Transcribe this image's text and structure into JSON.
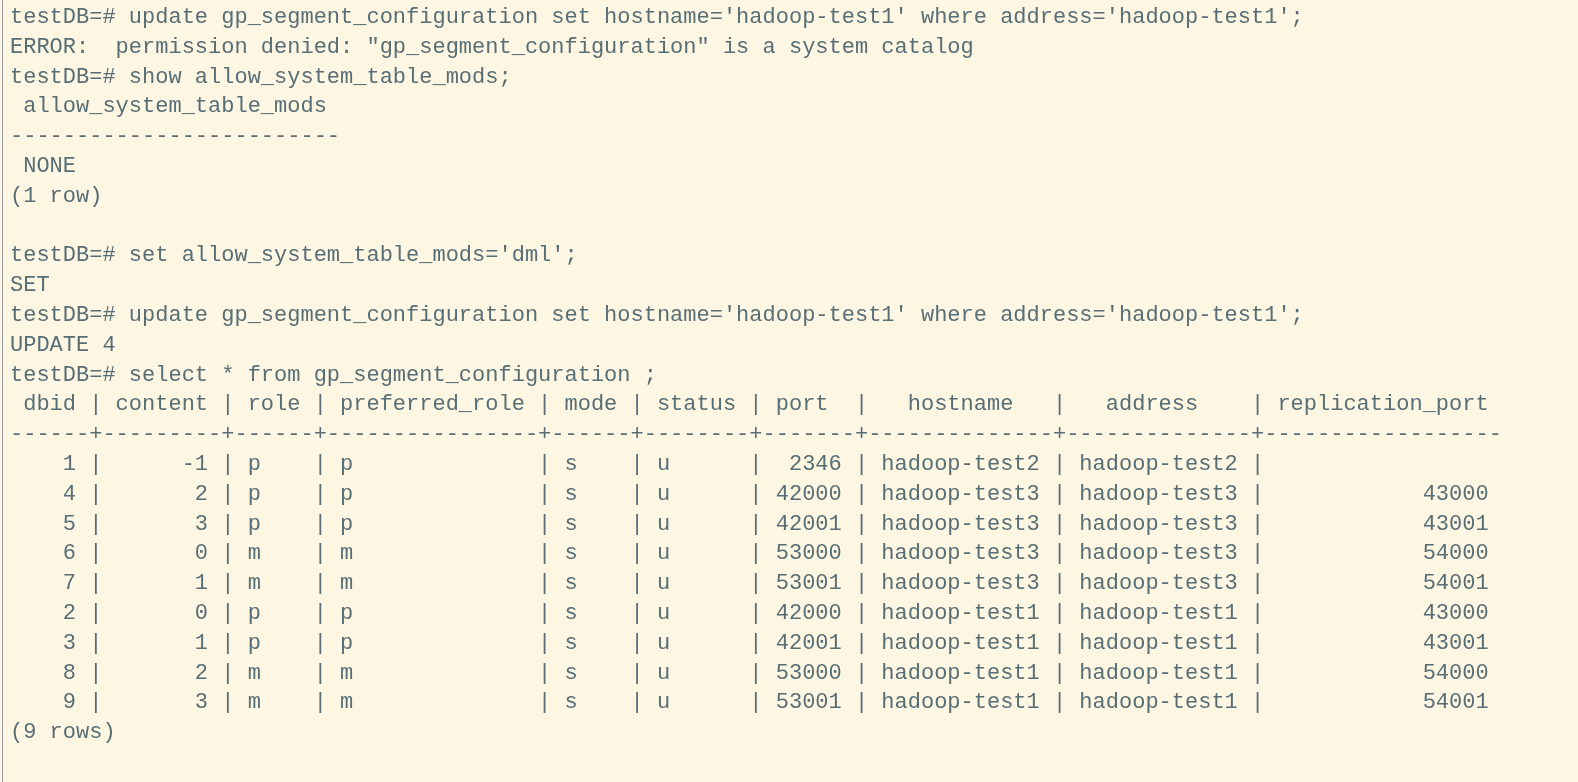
{
  "terminal": {
    "blocks": [
      {
        "lines": [
          "testDB=# update gp_segment_configuration set hostname='hadoop-test1' where address='hadoop-test1';",
          "ERROR:  permission denied: \"gp_segment_configuration\" is a system catalog",
          "testDB=# show allow_system_table_mods;",
          " allow_system_table_mods",
          "-------------------------",
          " NONE",
          "(1 row)"
        ]
      },
      {
        "lines": [
          "testDB=# set allow_system_table_mods='dml';",
          "SET",
          "testDB=# update gp_segment_configuration set hostname='hadoop-test1' where address='hadoop-test1';",
          "UPDATE 4",
          "testDB=# select * from gp_segment_configuration ;",
          " dbid | content | role | preferred_role | mode | status | port  |   hostname   |   address    | replication_port",
          "------+---------+------+----------------+------+--------+-------+--------------+--------------+------------------",
          "    1 |      -1 | p    | p              | s    | u      |  2346 | hadoop-test2 | hadoop-test2 |",
          "    4 |       2 | p    | p              | s    | u      | 42000 | hadoop-test3 | hadoop-test3 |            43000",
          "    5 |       3 | p    | p              | s    | u      | 42001 | hadoop-test3 | hadoop-test3 |            43001",
          "    6 |       0 | m    | m              | s    | u      | 53000 | hadoop-test3 | hadoop-test3 |            54000",
          "    7 |       1 | m    | m              | s    | u      | 53001 | hadoop-test3 | hadoop-test3 |            54001",
          "    2 |       0 | p    | p              | s    | u      | 42000 | hadoop-test1 | hadoop-test1 |            43000",
          "    3 |       1 | p    | p              | s    | u      | 42001 | hadoop-test1 | hadoop-test1 |            43001",
          "    8 |       2 | m    | m              | s    | u      | 53000 | hadoop-test1 | hadoop-test1 |            54000",
          "    9 |       3 | m    | m              | s    | u      | 53001 | hadoop-test1 | hadoop-test1 |            54001",
          "(9 rows)"
        ]
      }
    ]
  }
}
